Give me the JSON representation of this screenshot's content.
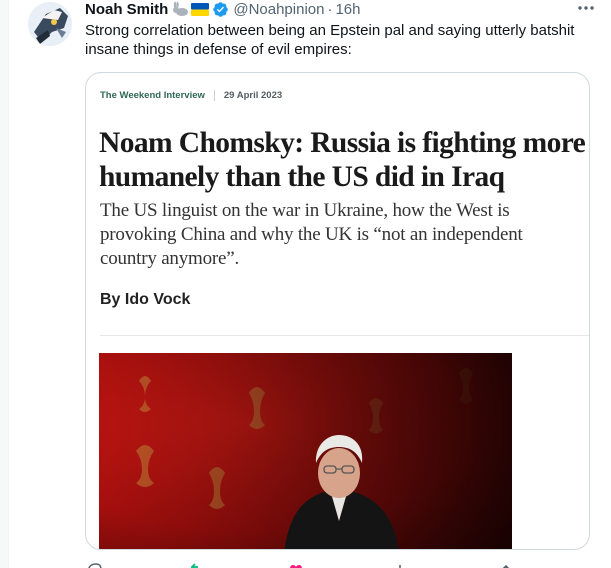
{
  "tweet": {
    "author_name": "Noah Smith",
    "handle": "@Noahpinion",
    "separator": "·",
    "time": "16h",
    "text": "Strong correlation between being an Epstein pal and saying utterly batshit insane things in defense of evil empires:"
  },
  "icons": {
    "name_badges": [
      "rabbit-emoji-icon",
      "ukraine-flag-icon",
      "verified-badge-icon"
    ],
    "more": "more-options-icon",
    "actions": [
      "reply-icon",
      "retweet-icon",
      "like-icon",
      "views-icon",
      "share-icon"
    ]
  },
  "colors": {
    "verified": "#1d9bf0",
    "section_label": "#2f6a55",
    "card_border": "#cfd9de",
    "photo_background": "#b8110f"
  },
  "card": {
    "section": "The Weekend Interview",
    "date": "29 April 2023",
    "headline": "Noam Chomsky: Russia is fighting more humanely than the US did in Iraq",
    "standfirst": "The US linguist on the war in Ukraine, how the West is provoking China and why the UK is “not an independent country anymore”.",
    "byline": "By Ido Vock"
  }
}
